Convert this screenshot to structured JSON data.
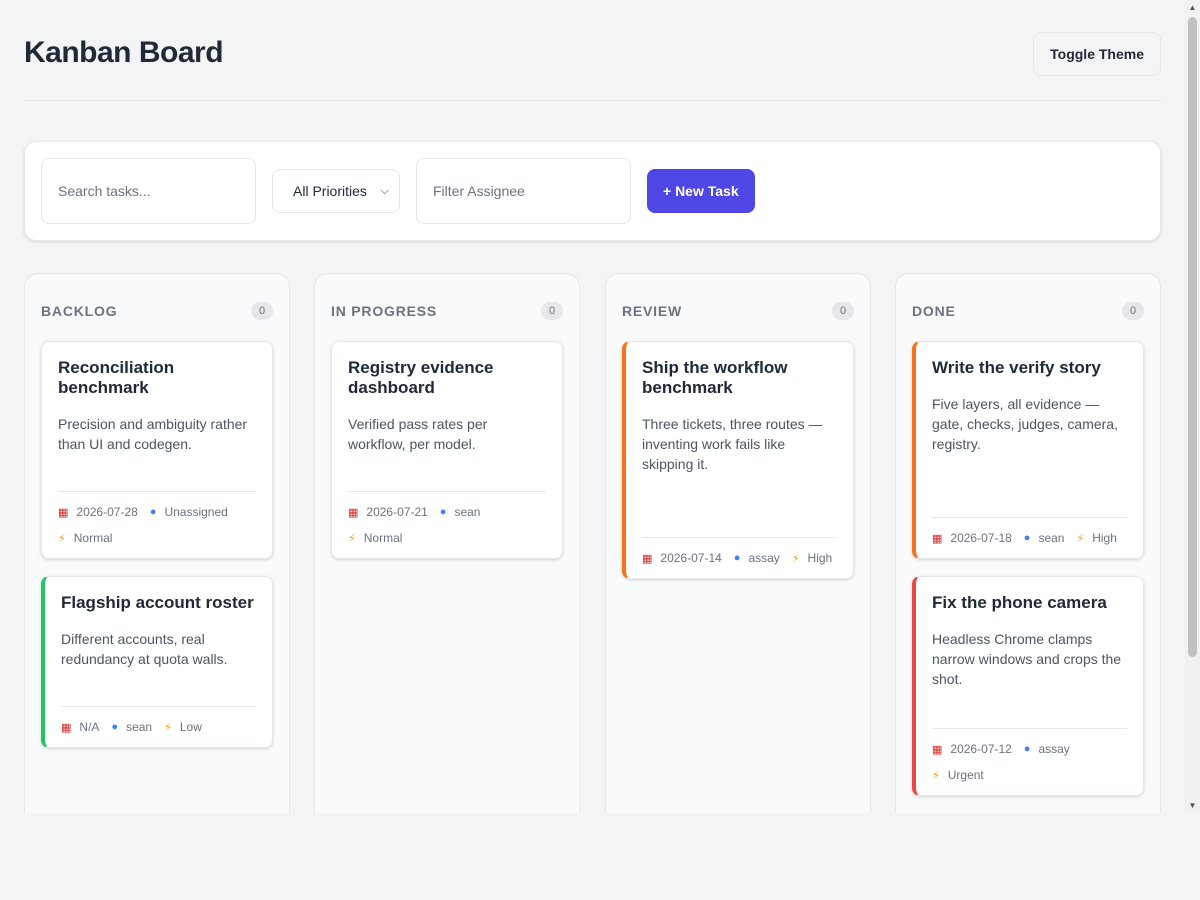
{
  "header": {
    "title": "Kanban Board",
    "theme_button": "Toggle Theme"
  },
  "toolbar": {
    "search_placeholder": "Search tasks...",
    "priority_select": "All Priorities",
    "assignee_placeholder": "Filter Assignee",
    "new_task_button": "+ New Task"
  },
  "colors": {
    "accent": "#4f46e5",
    "priority_low": "#22c55e",
    "priority_high": "#f97316",
    "priority_urgent": "#ef4444"
  },
  "columns": [
    {
      "title": "BACKLOG",
      "count": "0",
      "cards": [
        {
          "title": "Reconciliation benchmark",
          "description": "Precision and ambiguity rather than UI and codegen.",
          "date": "2026-07-28",
          "assignee": "Unassigned",
          "priority": "Normal"
        },
        {
          "title": "Flagship account roster",
          "description": "Different accounts, real redundancy at quota walls.",
          "date": "N/A",
          "assignee": "sean",
          "priority": "Low"
        }
      ]
    },
    {
      "title": "IN PROGRESS",
      "count": "0",
      "cards": [
        {
          "title": "Registry evidence dashboard",
          "description": "Verified pass rates per workflow, per model.",
          "date": "2026-07-21",
          "assignee": "sean",
          "priority": "Normal"
        }
      ]
    },
    {
      "title": "REVIEW",
      "count": "0",
      "cards": [
        {
          "title": "Ship the workflow benchmark",
          "description": "Three tickets, three routes — inventing work fails like skipping it.",
          "date": "2026-07-14",
          "assignee": "assay",
          "priority": "High"
        }
      ]
    },
    {
      "title": "DONE",
      "count": "0",
      "cards": [
        {
          "title": "Write the verify story",
          "description": "Five layers, all evidence — gate, checks, judges, camera, registry.",
          "date": "2026-07-18",
          "assignee": "sean",
          "priority": "High"
        },
        {
          "title": "Fix the phone camera",
          "description": "Headless Chrome clamps narrow windows and crops the shot.",
          "date": "2026-07-12",
          "assignee": "assay",
          "priority": "Urgent"
        }
      ]
    }
  ]
}
